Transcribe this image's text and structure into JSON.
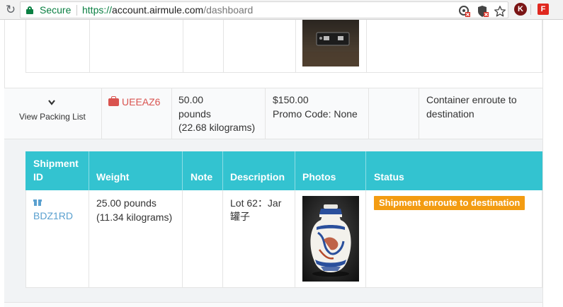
{
  "browser": {
    "secure_label": "Secure",
    "url_scheme": "https://",
    "url_host": "account.airmule.com",
    "url_path": "/dashboard",
    "extension_k_label": "K",
    "extension_f_label": "F",
    "icons": [
      "reload-icon",
      "lock-icon",
      "blocked-popup-icon",
      "shield-icon",
      "star-icon"
    ]
  },
  "parent_shipment": {
    "toggle_label": "View Packing List",
    "code": "UEEAZ6",
    "weight_line1": "50.00",
    "weight_line2": "pounds",
    "weight_line3": "(22.68 kilograms)",
    "price": "$150.00",
    "promo": "Promo Code: None",
    "status_line1": "Container enroute to",
    "status_line2": "destination"
  },
  "child_table": {
    "headers": {
      "shipment_id_line1": "Shipment",
      "shipment_id_line2": "ID",
      "weight": "Weight",
      "note": "Note",
      "description": "Description",
      "photos": "Photos",
      "status": "Status"
    },
    "rows": [
      {
        "shipment_id": "BDZ1RD",
        "weight_line1": "25.00 pounds",
        "weight_line2": "(11.34 kilograms)",
        "note": "",
        "description_line1": "Lot 62：Jar",
        "description_line2": "罐子",
        "status": "Shipment enroute to destination"
      }
    ]
  },
  "colors": {
    "header_teal": "#33c3d0",
    "status_orange": "#f39c12",
    "category_red": "#d9534f",
    "link_blue": "#5aa0cf",
    "secure_green": "#0b8043"
  }
}
